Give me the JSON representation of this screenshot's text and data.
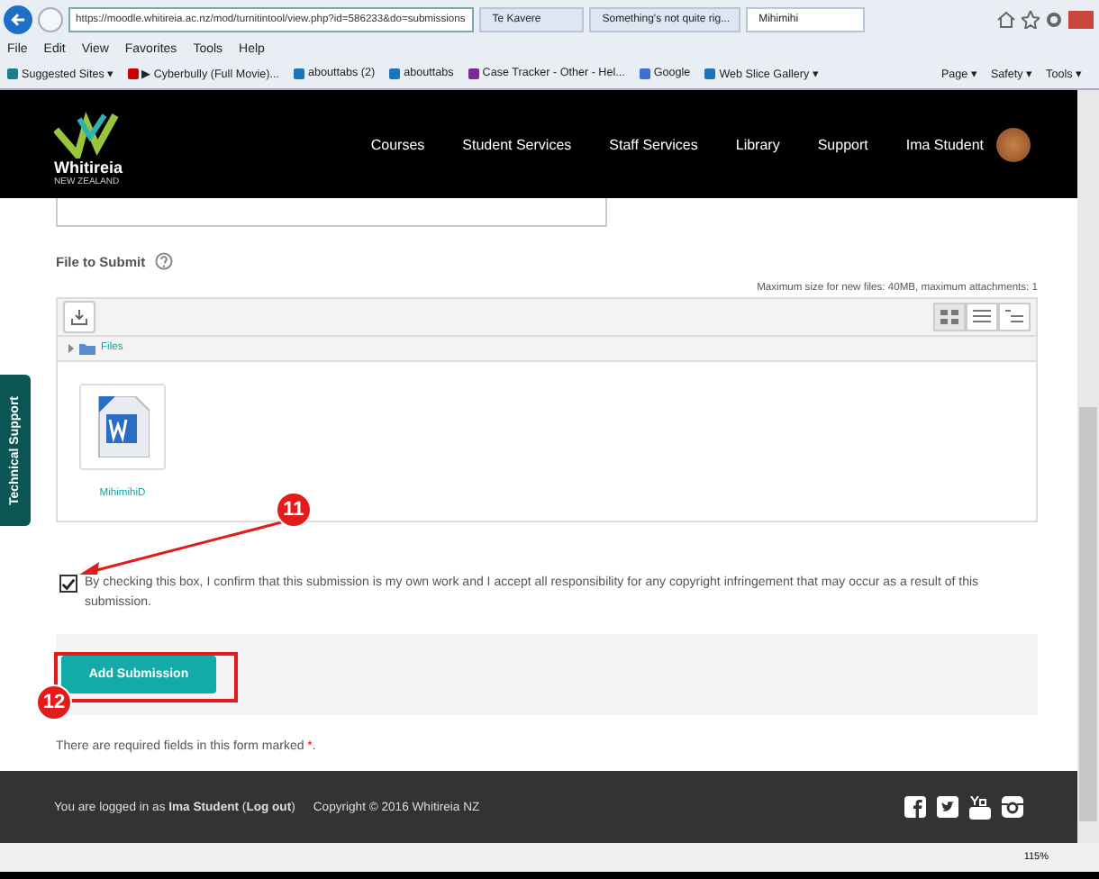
{
  "browser": {
    "url": "https://moodle.whitireia.ac.nz/mod/turnitintool/view.php?id=586233&do=submissions",
    "tabs": [
      {
        "label": "Te Kavere",
        "selected": false
      },
      {
        "label": "Something's not quite rig...",
        "selected": false
      },
      {
        "label": "Mihimihi",
        "selected": true
      }
    ],
    "menu": [
      "File",
      "Edit",
      "View",
      "Favorites",
      "Tools",
      "Help"
    ],
    "favorites": [
      {
        "label": "Suggested Sites ▾",
        "kind": "bing"
      },
      {
        "label": "▶ Cyberbully (Full Movie)...",
        "kind": "video"
      },
      {
        "label": "abouttabs (2)",
        "kind": "ie"
      },
      {
        "label": "abouttabs",
        "kind": "ie"
      },
      {
        "label": "Case Tracker - Other - Hel...",
        "kind": "star"
      },
      {
        "label": "Google",
        "kind": "google"
      },
      {
        "label": "Web Slice Gallery ▾",
        "kind": "ie"
      }
    ],
    "command_bar": [
      "Page ▾",
      "Safety ▾",
      "Tools ▾"
    ],
    "zoom": "115%"
  },
  "header": {
    "logo_name": "Whitireia",
    "logo_tagline": "NEW ZEALAND",
    "nav": [
      "Courses",
      "Student Services",
      "Staff Services",
      "Library",
      "Support"
    ],
    "user": "Ima Student"
  },
  "side_tab": "Technical Support",
  "form": {
    "file_label": "File to Submit",
    "limits": "Maximum size for new files: 40MB, maximum attachments: 1",
    "path": "Files",
    "view_modes": [
      {
        "selected": true
      },
      {
        "selected": false
      },
      {
        "selected": false
      }
    ],
    "files": [
      {
        "name": "MihimihiD"
      }
    ],
    "agreement": {
      "checked": true,
      "text": "By checking this box, I confirm that this submission is my own work and I accept all responsibility for any copyright infringement that may occur as a result of this submission."
    },
    "submit": "Add Submission",
    "required_note": {
      "text": "There are required fields in this form marked ",
      "marker": "*",
      "end": "."
    }
  },
  "footer": {
    "login": [
      {
        "kind": "text",
        "text": "You are logged in as "
      },
      {
        "kind": "bold",
        "text": "Ima Student"
      },
      {
        "kind": "text",
        "text": " ("
      },
      {
        "kind": "link",
        "text": "Log out"
      },
      {
        "kind": "text",
        "text": ")"
      }
    ],
    "copyright": "Copyright © 2016 Whitireia NZ"
  },
  "annotations": [
    {
      "label": "11",
      "kind": "arrow"
    },
    {
      "label": "12",
      "kind": "box"
    }
  ]
}
